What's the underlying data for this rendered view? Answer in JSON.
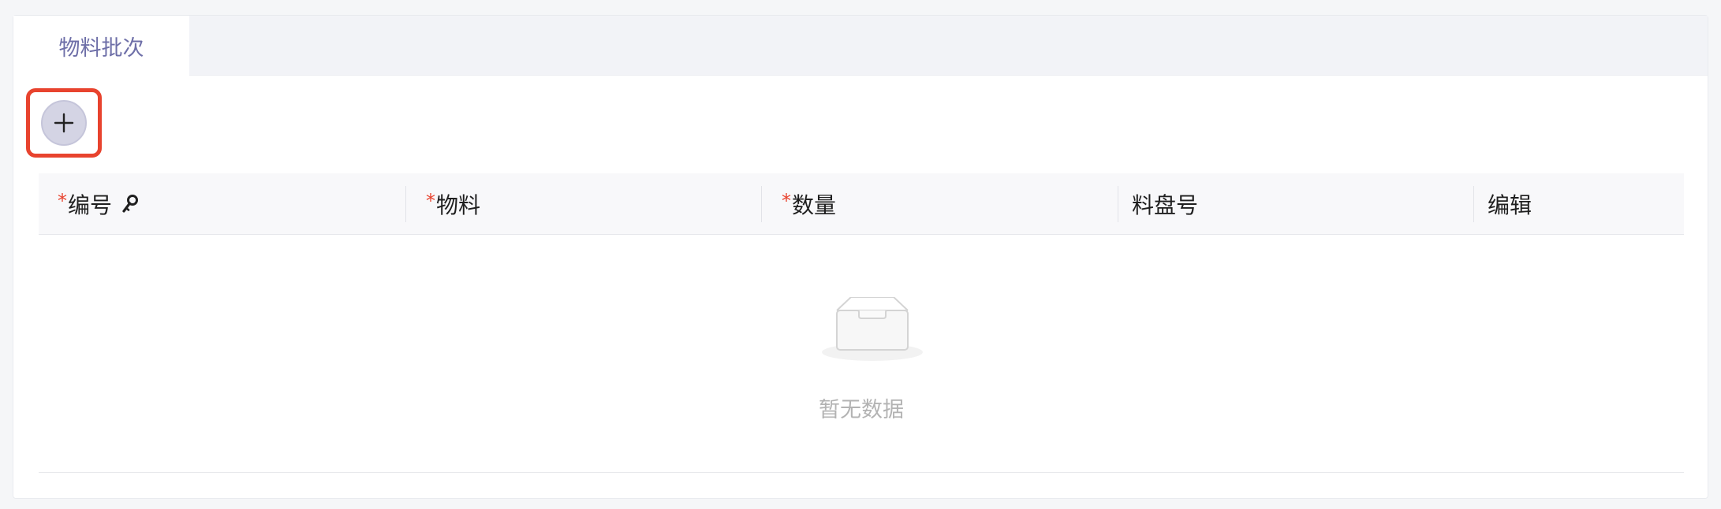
{
  "tabs": [
    {
      "label": "物料批次",
      "active": true
    }
  ],
  "toolbar": {
    "add_icon": "plus-icon"
  },
  "table": {
    "columns": [
      {
        "label": "编号",
        "required": true,
        "icon": "key-icon"
      },
      {
        "label": "物料",
        "required": true
      },
      {
        "label": "数量",
        "required": true
      },
      {
        "label": "料盘号",
        "required": false
      },
      {
        "label": "编辑",
        "required": false
      }
    ],
    "required_mark": "*",
    "rows": [],
    "empty_text": "暂无数据",
    "empty_icon": "empty-inbox-icon"
  },
  "colors": {
    "accent": "#6e6fa8",
    "required": "#e8432e",
    "highlight_border": "#e8432e"
  }
}
